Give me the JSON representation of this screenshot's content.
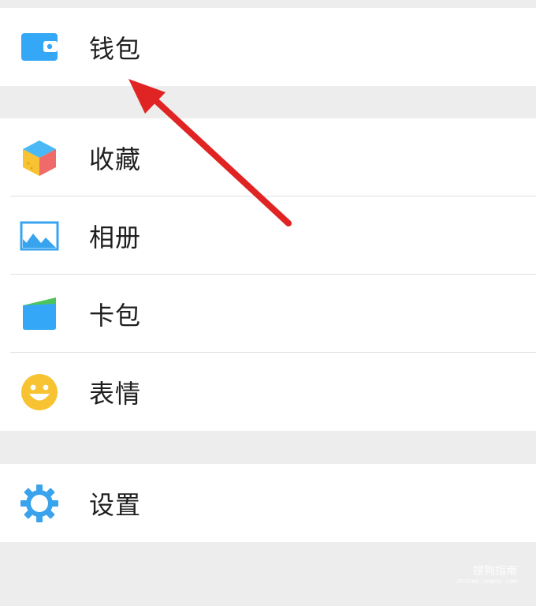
{
  "menu": {
    "wallet": {
      "label": "钱包",
      "icon": "wallet-icon",
      "color": "#35a7f7"
    },
    "favorites": {
      "label": "收藏",
      "icon": "cube-icon"
    },
    "album": {
      "label": "相册",
      "icon": "photo-icon",
      "color": "#38a4ef"
    },
    "cards": {
      "label": "卡包",
      "icon": "card-wallet-icon"
    },
    "stickers": {
      "label": "表情",
      "icon": "smiley-icon",
      "color": "#f7c332"
    },
    "settings": {
      "label": "设置",
      "icon": "gear-icon",
      "color": "#3ba2ec"
    }
  },
  "annotation": {
    "arrow_color": "#e02424"
  },
  "watermark": {
    "brand": "搜狗指南",
    "url": "zhinan.sogou.com"
  }
}
